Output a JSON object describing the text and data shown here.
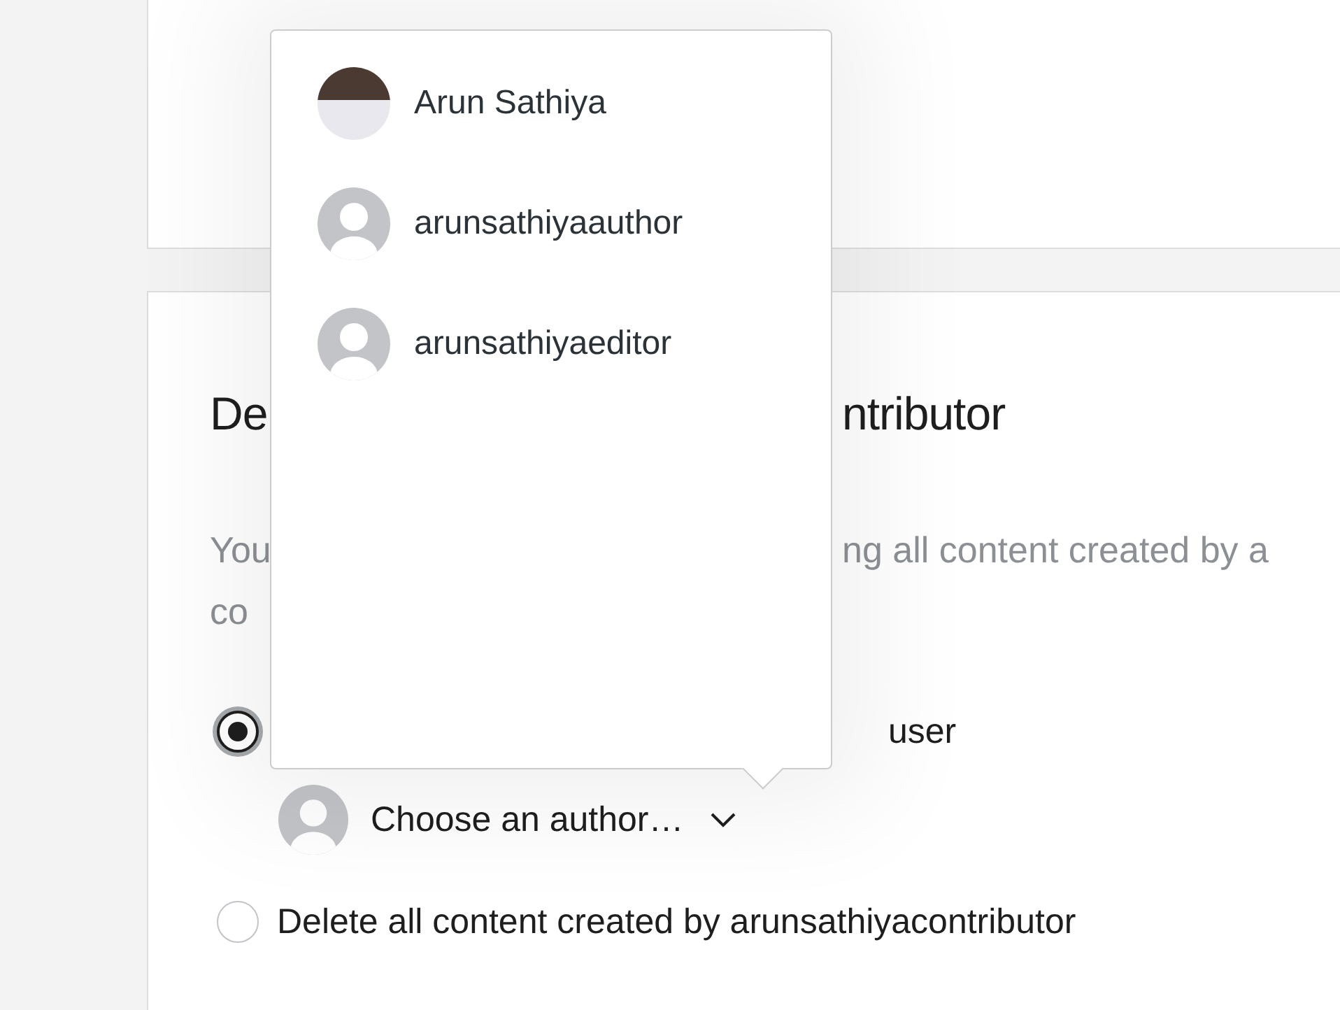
{
  "section": {
    "heading_parts": [
      "De",
      "ntributor"
    ],
    "description_lines": [
      [
        "You",
        "ng all content created by a"
      ],
      [
        "co"
      ]
    ],
    "options": [
      {
        "kind": "reassign",
        "label": "user",
        "selected": true
      },
      {
        "kind": "delete",
        "label": "Delete all content created by arunsathiyacontributor",
        "selected": false
      }
    ],
    "author_select": {
      "label": "Choose an author…"
    }
  },
  "author_menu": {
    "items": [
      {
        "name": "Arun Sathiya",
        "kind": "photo"
      },
      {
        "name": "arunsathiyaauthor",
        "kind": "default"
      },
      {
        "name": "arunsathiyaeditor",
        "kind": "default"
      }
    ]
  }
}
